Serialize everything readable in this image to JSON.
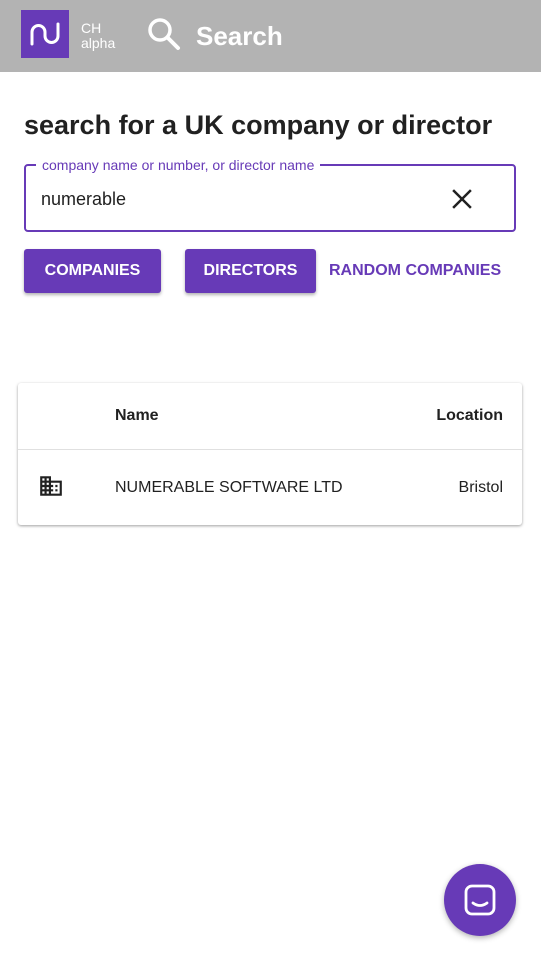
{
  "app": {
    "brand_line1": "CH",
    "brand_line2": "alpha",
    "nav_search_label": "Search",
    "accent_color": "#673ab7",
    "appbar_color": "#b3b3b3"
  },
  "page": {
    "heading": "search for a UK company or director"
  },
  "search": {
    "label": "company name or number, or director name",
    "value": "numerable"
  },
  "buttons": {
    "companies": "COMPANIES",
    "directors": "DIRECTORS",
    "random_companies": "RANDOM COMPANIES"
  },
  "results": {
    "columns": {
      "name": "Name",
      "location": "Location"
    },
    "rows": [
      {
        "icon": "building-icon",
        "name": "NUMERABLE SOFTWARE LTD",
        "location": "Bristol"
      }
    ]
  },
  "icons": {
    "logo": "nu-logo-icon",
    "search": "search-icon",
    "clear": "close-icon",
    "chat": "chat-icon"
  }
}
